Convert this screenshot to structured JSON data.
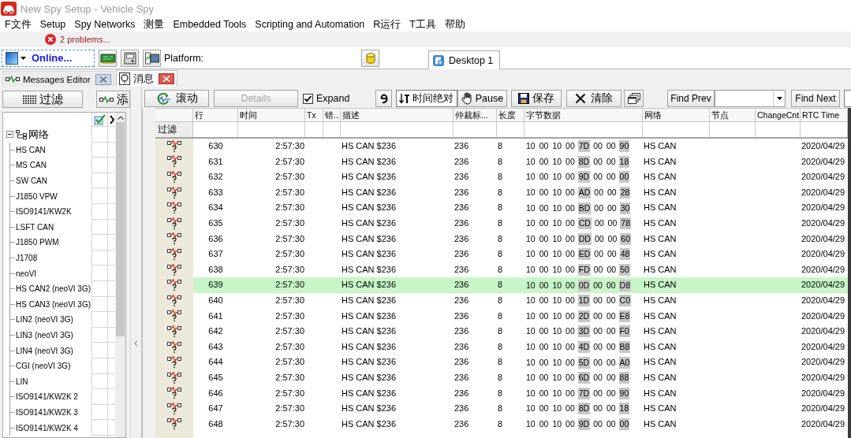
{
  "window": {
    "title": "New Spy Setup - Vehicle Spy"
  },
  "menu": [
    "F文件",
    "Setup",
    "Spy Networks",
    "测量",
    "Embedded Tools",
    "Scripting and Automation",
    "R运行",
    "T工具",
    "帮助"
  ],
  "problems": {
    "label": "2 problems..."
  },
  "toolbar": {
    "connection": "Online...",
    "platform_label": "Platform:"
  },
  "desktop_tabs": [
    {
      "label": "Desktop 1",
      "selected": true
    }
  ],
  "view_tabs": [
    {
      "label": "Messages Editor",
      "kind": "editor",
      "selected": false
    },
    {
      "label": "消息",
      "kind": "messages",
      "selected": true
    }
  ],
  "filter_panel": {
    "buttons": [
      {
        "label": "过滤",
        "kind": "filter"
      },
      {
        "label": "添",
        "kind": "add"
      }
    ],
    "tree": {
      "label": "网络",
      "expanded": true,
      "children": [
        {
          "label": "HS CAN"
        },
        {
          "label": "MS CAN"
        },
        {
          "label": "SW CAN"
        },
        {
          "label": "J1850 VPW"
        },
        {
          "label": "ISO9141/KW2K"
        },
        {
          "label": "LSFT CAN"
        },
        {
          "label": "J1850 PWM"
        },
        {
          "label": "J1708"
        },
        {
          "label": "neoVI"
        },
        {
          "label": "HS CAN2 (neoVI 3G)"
        },
        {
          "label": "HS CAN3 (neoVI 3G)"
        },
        {
          "label": "LIN2 (neoVI 3G)"
        },
        {
          "label": "LIN3 (neoVI 3G)"
        },
        {
          "label": "LIN4 (neoVI 3G)"
        },
        {
          "label": "CGI (neoVI 3G)"
        },
        {
          "label": "LIN"
        },
        {
          "label": "ISO9141/KW2K 2"
        },
        {
          "label": "ISO9141/KW2K 3"
        },
        {
          "label": "ISO9141/KW2K 4"
        }
      ]
    }
  },
  "message_toolbar": {
    "scroll": "滚动",
    "details": {
      "label": "Details",
      "disabled": true
    },
    "expand": {
      "label": "Expand",
      "checked": true
    },
    "time_mode": "时间绝对",
    "pause": "Pause",
    "save": "保存",
    "clear": "清除",
    "find_prev": "Find Prev",
    "find_next": "Find Next"
  },
  "table": {
    "columns": [
      "行",
      "时间",
      "Tx",
      "错..",
      "描述",
      "仲裁标...",
      "长度",
      "字节数据",
      "网络",
      "节点",
      "ChangeCnt",
      "RTC Time"
    ],
    "filter_label": "过滤",
    "rows": [
      {
        "line": "630",
        "time": "2:57:30",
        "description": "HS CAN $236",
        "arbitration_id": "236",
        "length": "8",
        "bytes": [
          {
            "value": "10",
            "changed": false
          },
          {
            "value": "00",
            "changed": false
          },
          {
            "value": "10",
            "changed": false
          },
          {
            "value": "00",
            "changed": false
          },
          {
            "value": "7D",
            "changed": true
          },
          {
            "value": "00",
            "changed": false
          },
          {
            "value": "00",
            "changed": false
          },
          {
            "value": "90",
            "changed": true
          }
        ],
        "network": "HS CAN",
        "rtc_time": "2020/04/29",
        "selected": false
      },
      {
        "line": "631",
        "time": "2:57:30",
        "description": "HS CAN $236",
        "arbitration_id": "236",
        "length": "8",
        "bytes": [
          {
            "value": "10",
            "changed": false
          },
          {
            "value": "00",
            "changed": false
          },
          {
            "value": "10",
            "changed": false
          },
          {
            "value": "00",
            "changed": false
          },
          {
            "value": "8D",
            "changed": true
          },
          {
            "value": "00",
            "changed": false
          },
          {
            "value": "00",
            "changed": false
          },
          {
            "value": "18",
            "changed": true
          }
        ],
        "network": "HS CAN",
        "rtc_time": "2020/04/29",
        "selected": false
      },
      {
        "line": "632",
        "time": "2:57:30",
        "description": "HS CAN $236",
        "arbitration_id": "236",
        "length": "8",
        "bytes": [
          {
            "value": "10",
            "changed": false
          },
          {
            "value": "00",
            "changed": false
          },
          {
            "value": "10",
            "changed": false
          },
          {
            "value": "00",
            "changed": false
          },
          {
            "value": "9D",
            "changed": true
          },
          {
            "value": "00",
            "changed": false
          },
          {
            "value": "00",
            "changed": false
          },
          {
            "value": "00",
            "changed": true
          }
        ],
        "network": "HS CAN",
        "rtc_time": "2020/04/29",
        "selected": false
      },
      {
        "line": "633",
        "time": "2:57:30",
        "description": "HS CAN $236",
        "arbitration_id": "236",
        "length": "8",
        "bytes": [
          {
            "value": "10",
            "changed": false
          },
          {
            "value": "00",
            "changed": false
          },
          {
            "value": "10",
            "changed": false
          },
          {
            "value": "00",
            "changed": false
          },
          {
            "value": "AD",
            "changed": true
          },
          {
            "value": "00",
            "changed": false
          },
          {
            "value": "00",
            "changed": false
          },
          {
            "value": "28",
            "changed": true
          }
        ],
        "network": "HS CAN",
        "rtc_time": "2020/04/29",
        "selected": false
      },
      {
        "line": "634",
        "time": "2:57:30",
        "description": "HS CAN $236",
        "arbitration_id": "236",
        "length": "8",
        "bytes": [
          {
            "value": "10",
            "changed": false
          },
          {
            "value": "00",
            "changed": false
          },
          {
            "value": "10",
            "changed": false
          },
          {
            "value": "00",
            "changed": false
          },
          {
            "value": "BD",
            "changed": true
          },
          {
            "value": "00",
            "changed": false
          },
          {
            "value": "00",
            "changed": false
          },
          {
            "value": "30",
            "changed": true
          }
        ],
        "network": "HS CAN",
        "rtc_time": "2020/04/29",
        "selected": false
      },
      {
        "line": "635",
        "time": "2:57:30",
        "description": "HS CAN $236",
        "arbitration_id": "236",
        "length": "8",
        "bytes": [
          {
            "value": "10",
            "changed": false
          },
          {
            "value": "00",
            "changed": false
          },
          {
            "value": "10",
            "changed": false
          },
          {
            "value": "00",
            "changed": false
          },
          {
            "value": "CD",
            "changed": true
          },
          {
            "value": "00",
            "changed": false
          },
          {
            "value": "00",
            "changed": false
          },
          {
            "value": "78",
            "changed": true
          }
        ],
        "network": "HS CAN",
        "rtc_time": "2020/04/29",
        "selected": false
      },
      {
        "line": "636",
        "time": "2:57:30",
        "description": "HS CAN $236",
        "arbitration_id": "236",
        "length": "8",
        "bytes": [
          {
            "value": "10",
            "changed": false
          },
          {
            "value": "00",
            "changed": false
          },
          {
            "value": "10",
            "changed": false
          },
          {
            "value": "00",
            "changed": false
          },
          {
            "value": "DD",
            "changed": true
          },
          {
            "value": "00",
            "changed": false
          },
          {
            "value": "00",
            "changed": false
          },
          {
            "value": "60",
            "changed": true
          }
        ],
        "network": "HS CAN",
        "rtc_time": "2020/04/29",
        "selected": false
      },
      {
        "line": "637",
        "time": "2:57:30",
        "description": "HS CAN $236",
        "arbitration_id": "236",
        "length": "8",
        "bytes": [
          {
            "value": "10",
            "changed": false
          },
          {
            "value": "00",
            "changed": false
          },
          {
            "value": "10",
            "changed": false
          },
          {
            "value": "00",
            "changed": false
          },
          {
            "value": "ED",
            "changed": true
          },
          {
            "value": "00",
            "changed": false
          },
          {
            "value": "00",
            "changed": false
          },
          {
            "value": "48",
            "changed": true
          }
        ],
        "network": "HS CAN",
        "rtc_time": "2020/04/29",
        "selected": false
      },
      {
        "line": "638",
        "time": "2:57:30",
        "description": "HS CAN $236",
        "arbitration_id": "236",
        "length": "8",
        "bytes": [
          {
            "value": "10",
            "changed": false
          },
          {
            "value": "00",
            "changed": false
          },
          {
            "value": "10",
            "changed": false
          },
          {
            "value": "00",
            "changed": false
          },
          {
            "value": "FD",
            "changed": true
          },
          {
            "value": "00",
            "changed": false
          },
          {
            "value": "00",
            "changed": false
          },
          {
            "value": "50",
            "changed": true
          }
        ],
        "network": "HS CAN",
        "rtc_time": "2020/04/29",
        "selected": false
      },
      {
        "line": "639",
        "time": "2:57:30",
        "description": "HS CAN $236",
        "arbitration_id": "236",
        "length": "8",
        "bytes": [
          {
            "value": "10",
            "changed": false
          },
          {
            "value": "00",
            "changed": false
          },
          {
            "value": "10",
            "changed": false
          },
          {
            "value": "00",
            "changed": false
          },
          {
            "value": "0D",
            "changed": true
          },
          {
            "value": "00",
            "changed": false
          },
          {
            "value": "00",
            "changed": false
          },
          {
            "value": "D8",
            "changed": true
          }
        ],
        "network": "HS CAN",
        "rtc_time": "2020/04/29",
        "selected": true
      },
      {
        "line": "640",
        "time": "2:57:30",
        "description": "HS CAN $236",
        "arbitration_id": "236",
        "length": "8",
        "bytes": [
          {
            "value": "10",
            "changed": false
          },
          {
            "value": "00",
            "changed": false
          },
          {
            "value": "10",
            "changed": false
          },
          {
            "value": "00",
            "changed": false
          },
          {
            "value": "1D",
            "changed": true
          },
          {
            "value": "00",
            "changed": false
          },
          {
            "value": "00",
            "changed": false
          },
          {
            "value": "C0",
            "changed": true
          }
        ],
        "network": "HS CAN",
        "rtc_time": "2020/04/29",
        "selected": false
      },
      {
        "line": "641",
        "time": "2:57:30",
        "description": "HS CAN $236",
        "arbitration_id": "236",
        "length": "8",
        "bytes": [
          {
            "value": "10",
            "changed": false
          },
          {
            "value": "00",
            "changed": false
          },
          {
            "value": "10",
            "changed": false
          },
          {
            "value": "00",
            "changed": false
          },
          {
            "value": "2D",
            "changed": true
          },
          {
            "value": "00",
            "changed": false
          },
          {
            "value": "00",
            "changed": false
          },
          {
            "value": "E8",
            "changed": true
          }
        ],
        "network": "HS CAN",
        "rtc_time": "2020/04/29",
        "selected": false
      },
      {
        "line": "642",
        "time": "2:57:30",
        "description": "HS CAN $236",
        "arbitration_id": "236",
        "length": "8",
        "bytes": [
          {
            "value": "10",
            "changed": false
          },
          {
            "value": "00",
            "changed": false
          },
          {
            "value": "10",
            "changed": false
          },
          {
            "value": "00",
            "changed": false
          },
          {
            "value": "3D",
            "changed": true
          },
          {
            "value": "00",
            "changed": false
          },
          {
            "value": "00",
            "changed": false
          },
          {
            "value": "F0",
            "changed": true
          }
        ],
        "network": "HS CAN",
        "rtc_time": "2020/04/29",
        "selected": false
      },
      {
        "line": "643",
        "time": "2:57:30",
        "description": "HS CAN $236",
        "arbitration_id": "236",
        "length": "8",
        "bytes": [
          {
            "value": "10",
            "changed": false
          },
          {
            "value": "00",
            "changed": false
          },
          {
            "value": "10",
            "changed": false
          },
          {
            "value": "00",
            "changed": false
          },
          {
            "value": "4D",
            "changed": true
          },
          {
            "value": "00",
            "changed": false
          },
          {
            "value": "00",
            "changed": false
          },
          {
            "value": "B8",
            "changed": true
          }
        ],
        "network": "HS CAN",
        "rtc_time": "2020/04/29",
        "selected": false
      },
      {
        "line": "644",
        "time": "2:57:30",
        "description": "HS CAN $236",
        "arbitration_id": "236",
        "length": "8",
        "bytes": [
          {
            "value": "10",
            "changed": false
          },
          {
            "value": "00",
            "changed": false
          },
          {
            "value": "10",
            "changed": false
          },
          {
            "value": "00",
            "changed": false
          },
          {
            "value": "5D",
            "changed": true
          },
          {
            "value": "00",
            "changed": false
          },
          {
            "value": "00",
            "changed": false
          },
          {
            "value": "A0",
            "changed": true
          }
        ],
        "network": "HS CAN",
        "rtc_time": "2020/04/29",
        "selected": false
      },
      {
        "line": "645",
        "time": "2:57:30",
        "description": "HS CAN $236",
        "arbitration_id": "236",
        "length": "8",
        "bytes": [
          {
            "value": "10",
            "changed": false
          },
          {
            "value": "00",
            "changed": false
          },
          {
            "value": "10",
            "changed": false
          },
          {
            "value": "00",
            "changed": false
          },
          {
            "value": "6D",
            "changed": true
          },
          {
            "value": "00",
            "changed": false
          },
          {
            "value": "00",
            "changed": false
          },
          {
            "value": "88",
            "changed": true
          }
        ],
        "network": "HS CAN",
        "rtc_time": "2020/04/29",
        "selected": false
      },
      {
        "line": "646",
        "time": "2:57:30",
        "description": "HS CAN $236",
        "arbitration_id": "236",
        "length": "8",
        "bytes": [
          {
            "value": "10",
            "changed": false
          },
          {
            "value": "00",
            "changed": false
          },
          {
            "value": "10",
            "changed": false
          },
          {
            "value": "00",
            "changed": false
          },
          {
            "value": "7D",
            "changed": true
          },
          {
            "value": "00",
            "changed": false
          },
          {
            "value": "00",
            "changed": false
          },
          {
            "value": "90",
            "changed": true
          }
        ],
        "network": "HS CAN",
        "rtc_time": "2020/04/29",
        "selected": false
      },
      {
        "line": "647",
        "time": "2:57:30",
        "description": "HS CAN $236",
        "arbitration_id": "236",
        "length": "8",
        "bytes": [
          {
            "value": "10",
            "changed": false
          },
          {
            "value": "00",
            "changed": false
          },
          {
            "value": "10",
            "changed": false
          },
          {
            "value": "00",
            "changed": false
          },
          {
            "value": "8D",
            "changed": true
          },
          {
            "value": "00",
            "changed": false
          },
          {
            "value": "00",
            "changed": false
          },
          {
            "value": "18",
            "changed": true
          }
        ],
        "network": "HS CAN",
        "rtc_time": "2020/04/29",
        "selected": false
      },
      {
        "line": "648",
        "time": "2:57:30",
        "description": "HS CAN $236",
        "arbitration_id": "236",
        "length": "8",
        "bytes": [
          {
            "value": "10",
            "changed": false
          },
          {
            "value": "00",
            "changed": false
          },
          {
            "value": "10",
            "changed": false
          },
          {
            "value": "00",
            "changed": false
          },
          {
            "value": "9D",
            "changed": true
          },
          {
            "value": "00",
            "changed": false
          },
          {
            "value": "00",
            "changed": false
          },
          {
            "value": "00",
            "changed": true
          }
        ],
        "network": "HS CAN",
        "rtc_time": "2020/04/29",
        "selected": false
      }
    ]
  }
}
